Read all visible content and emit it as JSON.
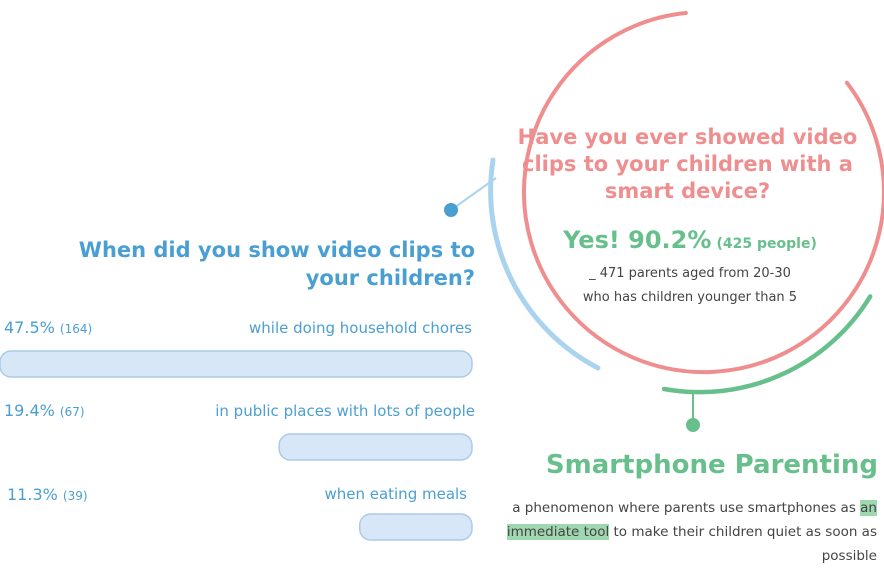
{
  "colors": {
    "pink": "#ef8e8f",
    "green": "#67c08c",
    "blue": "#4a9fd2",
    "light_blue": "#a9d3ef",
    "bar_fill": "#d7e7f7",
    "bar_stroke": "#a9cbe9",
    "highlight": "#9fd7b0"
  },
  "survey": {
    "question": "Have you ever showed video clips to your children with a smart device?",
    "yes_label": "Yes! 90.2%",
    "yes_count": "(425 people)",
    "sample_line1": "_ 471 parents aged from 20-30",
    "sample_line2": "who has children younger than 5"
  },
  "definition": {
    "title": "Smartphone Parenting",
    "text_part1": "a phenomenon where parents use smartphones as",
    "highlight": "an immediate tool",
    "text_part2": "to make their children quiet as soon as possible"
  },
  "chart_data": {
    "type": "bar",
    "orientation": "horizontal",
    "title": "When did you show video clips to your children?",
    "categories": [
      "while doing household chores",
      "in public places with lots of people",
      "when eating meals"
    ],
    "values": [
      47.5,
      19.4,
      11.3
    ],
    "value_labels": [
      "47.5%",
      "19.4%",
      "11.3%"
    ],
    "counts": [
      164,
      67,
      39
    ],
    "count_labels": [
      "(164)",
      "(67)",
      "(39)"
    ],
    "unit": "%",
    "bars_grow_from": "right",
    "xlim": [
      0,
      47.5
    ]
  }
}
